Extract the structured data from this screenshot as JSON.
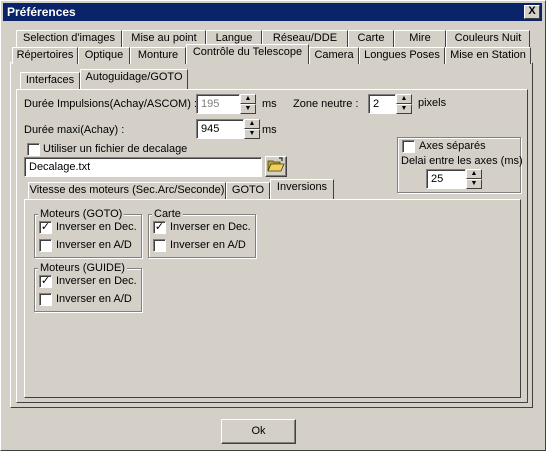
{
  "window": {
    "title": "Préférences",
    "close_glyph": "X"
  },
  "main_tabs_row1": [
    "Selection d'images",
    "Mise au point",
    "Langue",
    "Réseau/DDE",
    "Carte",
    "Mire",
    "Couleurs Nuit"
  ],
  "main_tabs_row2": [
    "Répertoires",
    "Optique",
    "Monture",
    "Contrôle du Telescope",
    "Camera",
    "Longues Poses",
    "Mise en Station"
  ],
  "sub_tabs": [
    "Interfaces",
    "Autoguidage/GOTO"
  ],
  "form": {
    "impulse_label": "Durée Impulsions(Achay/ASCOM) :",
    "impulse_value": "195",
    "impulse_unit": "ms",
    "deadzone_label": "Zone neutre :",
    "deadzone_value": "2",
    "deadzone_unit": "pixels",
    "maxdur_label": "Durée maxi(Achay) :",
    "maxdur_value": "945",
    "maxdur_unit": "ms",
    "use_offset_label": "Utiliser un fichier de decalage",
    "offset_file_value": "Decalage.txt"
  },
  "axes_box": {
    "separate_label": "Axes séparés",
    "delay_label": "Delai entre les axes (ms)",
    "delay_value": "25"
  },
  "inner_tabs": [
    "Vitesse des moteurs (Sec.Arc/Seconde)",
    "GOTO",
    "Inversions"
  ],
  "groups": {
    "goto": {
      "title": "Moteurs (GOTO)",
      "dec_label": "Inverser en Dec.",
      "ad_label": "Inverser en A/D"
    },
    "carte": {
      "title": "Carte",
      "dec_label": "Inverser en Dec.",
      "ad_label": "Inverser en A/D"
    },
    "guide": {
      "title": "Moteurs (GUIDE)",
      "dec_label": "Inverser en Dec.",
      "ad_label": "Inverser en A/D"
    }
  },
  "check_glyph": "✓",
  "ok_label": "Ok"
}
